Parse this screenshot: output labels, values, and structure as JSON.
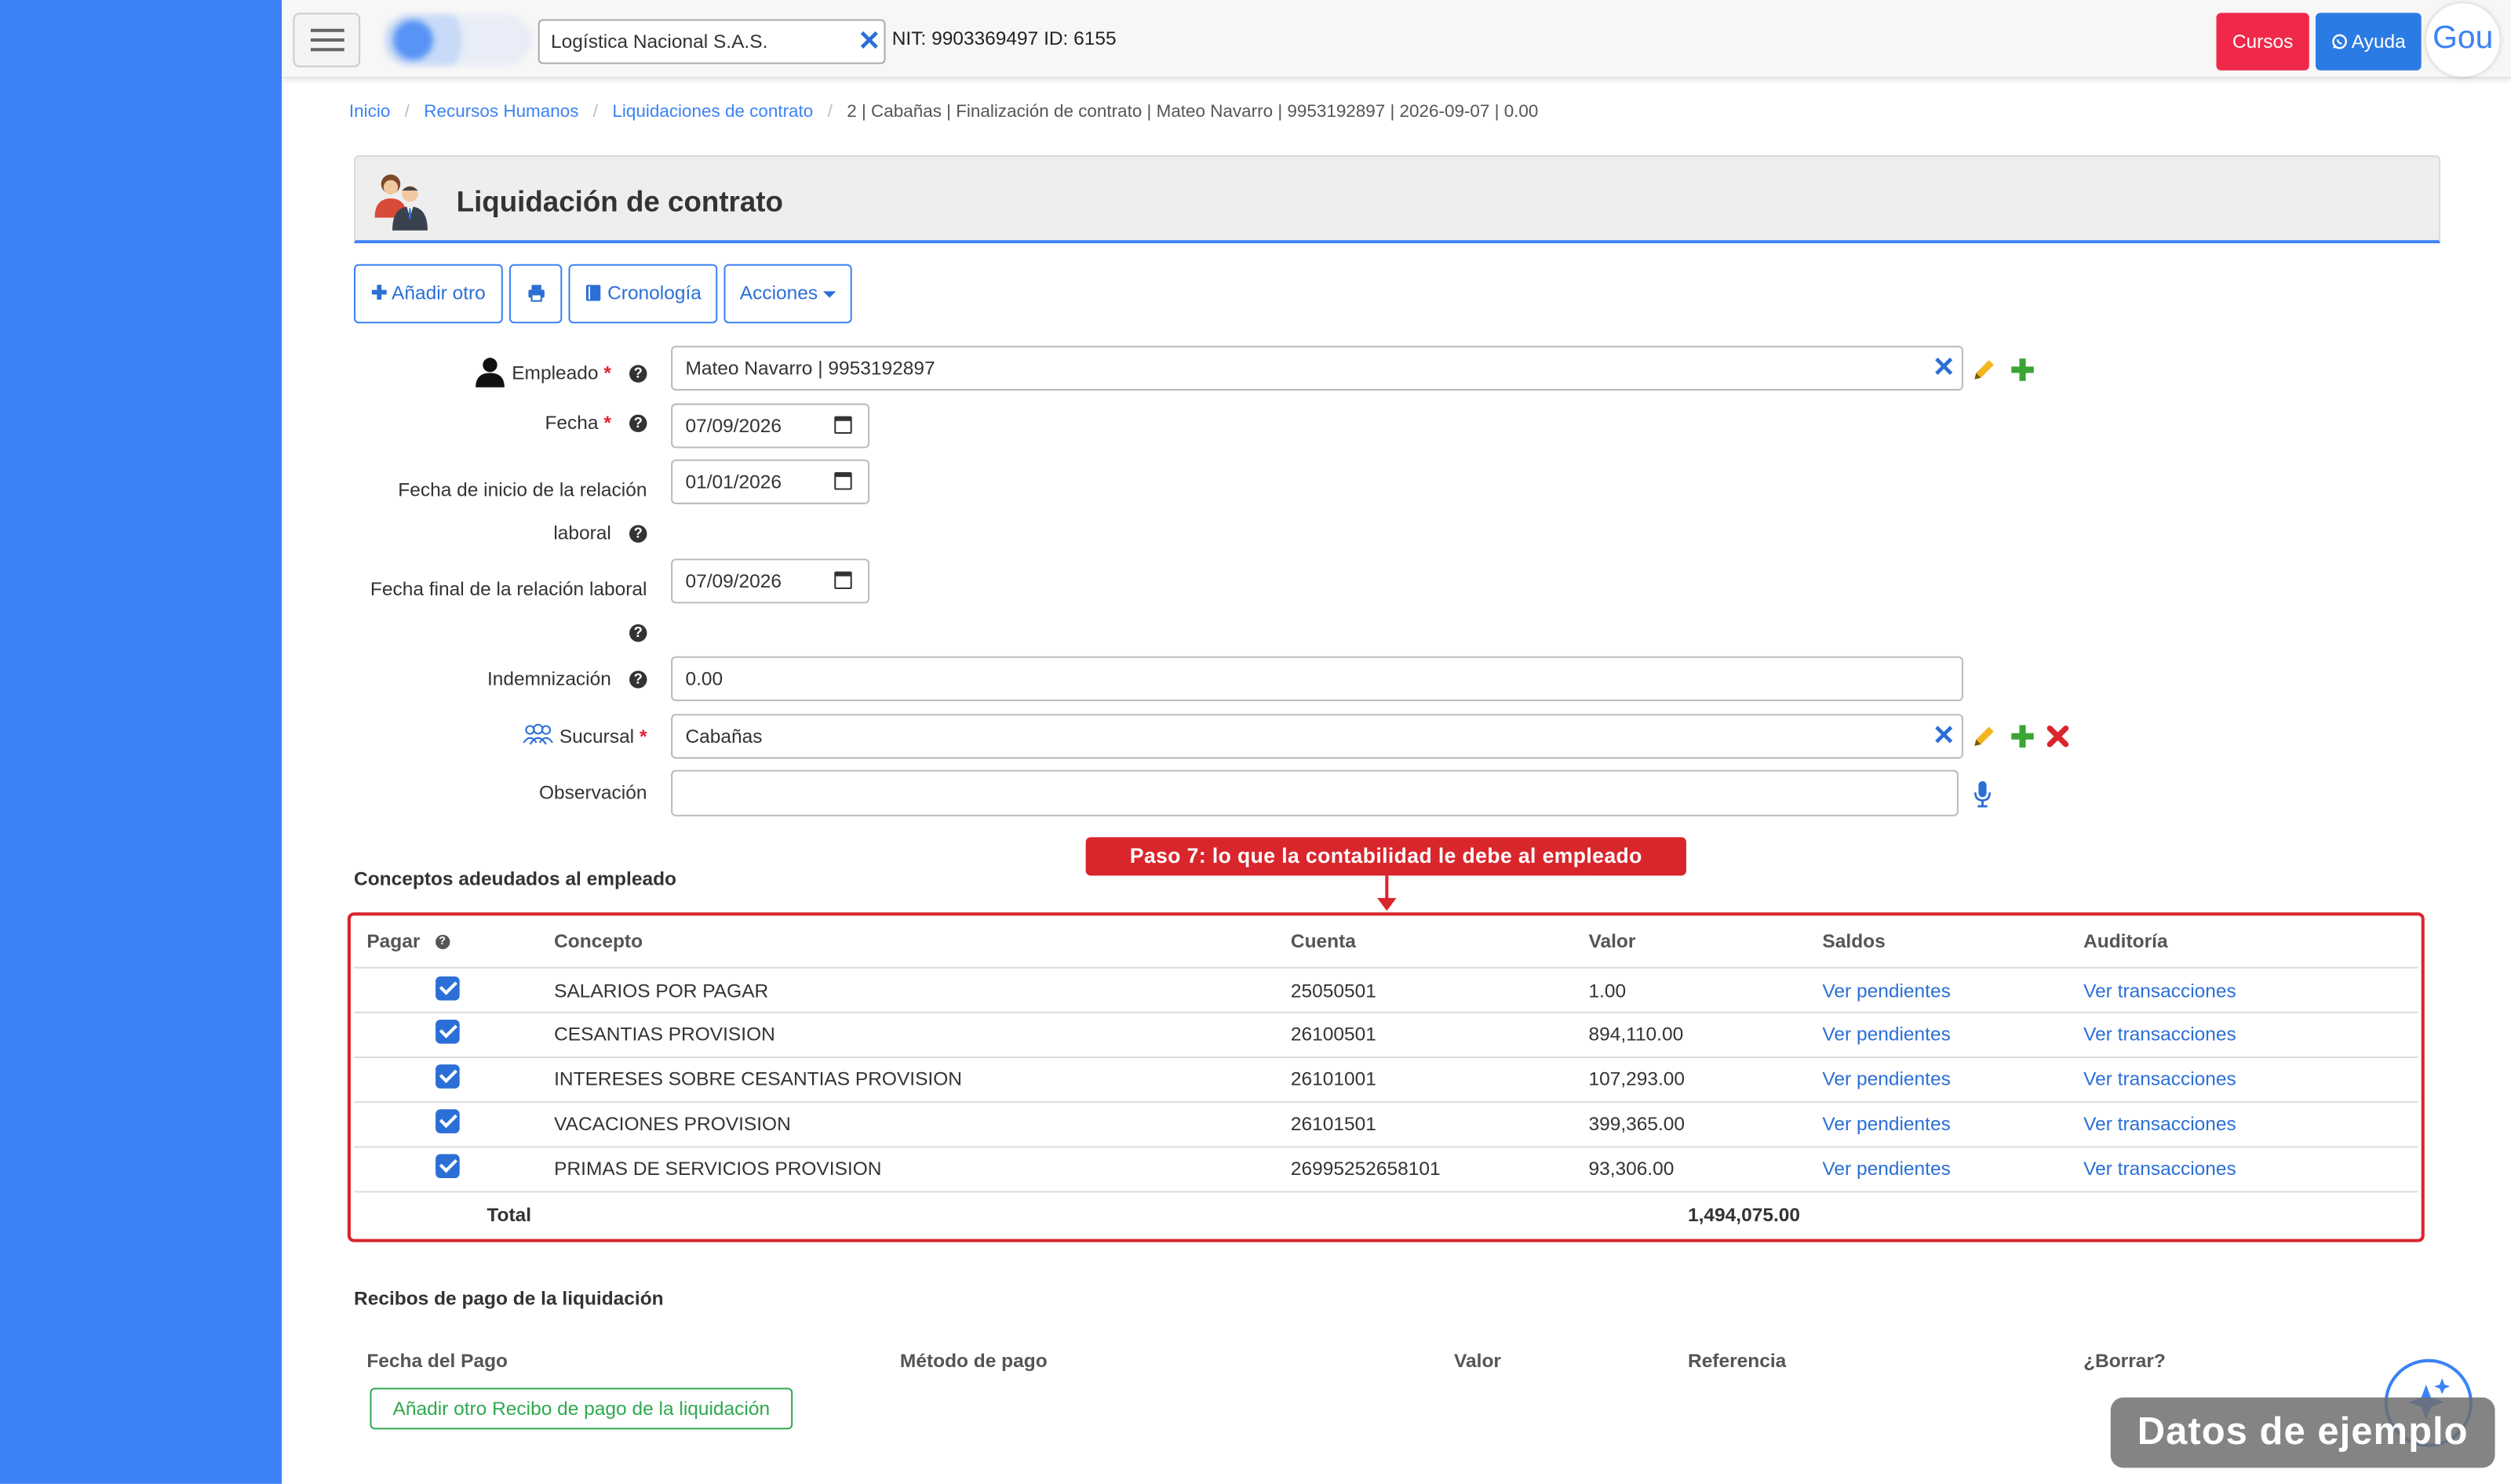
{
  "topbar": {
    "company": "Logística Nacional S.A.S.",
    "nit_info": "NIT: 9903369497 ID: 6155",
    "cursos_label": "Cursos",
    "ayuda_label": "Ayuda",
    "avatar_text": "Gou"
  },
  "breadcrumb": {
    "items": [
      "Inicio",
      "Recursos Humanos",
      "Liquidaciones de contrato"
    ],
    "current": "2 | Cabañas | Finalización de contrato | Mateo Navarro | 9953192897 | 2026-09-07 | 0.00"
  },
  "page": {
    "title": "Liquidación de contrato"
  },
  "toolbar": {
    "add_label": "Añadir otro",
    "cronologia_label": "Cronología",
    "acciones_label": "Acciones"
  },
  "form": {
    "empleado_label": "Empleado",
    "empleado_value": "Mateo Navarro | 9953192897",
    "fecha_label": "Fecha",
    "fecha_value": "07/09/2026",
    "fecha_inicio_label_1": "Fecha de inicio de la relación",
    "fecha_inicio_label_2": "laboral",
    "fecha_inicio_value": "01/01/2026",
    "fecha_final_label": "Fecha final de la relación laboral",
    "fecha_final_value": "07/09/2026",
    "indemnizacion_label": "Indemnización",
    "indemnizacion_value": "0.00",
    "sucursal_label": "Sucursal",
    "sucursal_value": "Cabañas",
    "observacion_label": "Observación",
    "observacion_value": ""
  },
  "conceptos": {
    "title": "Conceptos adeudados al empleado",
    "callout": "Paso 7: lo que la contabilidad le debe al empleado",
    "headers": {
      "pagar": "Pagar",
      "concepto": "Concepto",
      "cuenta": "Cuenta",
      "valor": "Valor",
      "saldos": "Saldos",
      "auditoria": "Auditoría"
    },
    "rows": [
      {
        "concepto": "SALARIOS POR PAGAR",
        "cuenta": "25050501",
        "valor": "1.00",
        "saldos": "Ver pendientes",
        "auditoria": "Ver transacciones",
        "pagar": true
      },
      {
        "concepto": "CESANTIAS PROVISION",
        "cuenta": "26100501",
        "valor": "894,110.00",
        "saldos": "Ver pendientes",
        "auditoria": "Ver transacciones",
        "pagar": true
      },
      {
        "concepto": "INTERESES SOBRE CESANTIAS PROVISION",
        "cuenta": "26101001",
        "valor": "107,293.00",
        "saldos": "Ver pendientes",
        "auditoria": "Ver transacciones",
        "pagar": true
      },
      {
        "concepto": "VACACIONES PROVISION",
        "cuenta": "26101501",
        "valor": "399,365.00",
        "saldos": "Ver pendientes",
        "auditoria": "Ver transacciones",
        "pagar": true
      },
      {
        "concepto": "PRIMAS DE SERVICIOS PROVISION",
        "cuenta": "26995252658101",
        "valor": "93,306.00",
        "saldos": "Ver pendientes",
        "auditoria": "Ver transacciones",
        "pagar": true
      }
    ],
    "total_label": "Total",
    "total_value": "1,494,075.00"
  },
  "recibos": {
    "title": "Recibos de pago de la liquidación",
    "headers": {
      "fecha": "Fecha del Pago",
      "metodo": "Método de pago",
      "valor": "Valor",
      "referencia": "Referencia",
      "borrar": "¿Borrar?"
    },
    "add_label": "Añadir otro Recibo de pago de la liquidación"
  },
  "watermark": "Datos de ejemplo",
  "colors": {
    "sidebar": "#3b82f6",
    "accent": "#2b6fd6",
    "danger": "#d9252c",
    "success": "#2fa84f",
    "cursos": "#f0294a"
  }
}
